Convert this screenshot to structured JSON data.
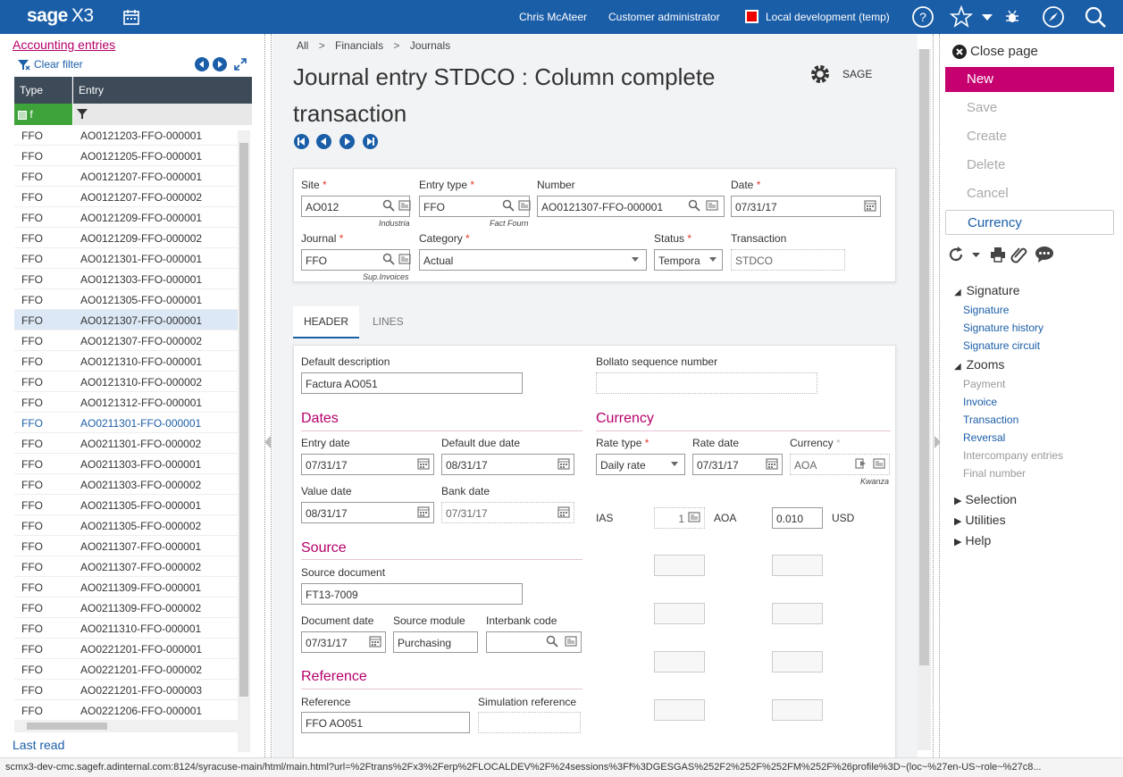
{
  "topbar": {
    "brand": "sage",
    "product": "X3",
    "user": "Chris McAteer",
    "role": "Customer administrator",
    "endpoint": "Local development (temp)",
    "color": "#1b5ea8"
  },
  "left": {
    "title": "Accounting entries",
    "clear_filter": "Clear filter",
    "col_type": "Type",
    "col_entry": "Entry",
    "filter_value": "f",
    "rows": [
      [
        "FFO",
        "AO0121203-FFO-000001"
      ],
      [
        "FFO",
        "AO0121205-FFO-000001"
      ],
      [
        "FFO",
        "AO0121207-FFO-000001"
      ],
      [
        "FFO",
        "AO0121207-FFO-000002"
      ],
      [
        "FFO",
        "AO0121209-FFO-000001"
      ],
      [
        "FFO",
        "AO0121209-FFO-000002"
      ],
      [
        "FFO",
        "AO0121301-FFO-000001"
      ],
      [
        "FFO",
        "AO0121303-FFO-000001"
      ],
      [
        "FFO",
        "AO0121305-FFO-000001"
      ],
      [
        "FFO",
        "AO0121307-FFO-000001"
      ],
      [
        "FFO",
        "AO0121307-FFO-000002"
      ],
      [
        "FFO",
        "AO0121310-FFO-000001"
      ],
      [
        "FFO",
        "AO0121310-FFO-000002"
      ],
      [
        "FFO",
        "AO0121312-FFO-000001"
      ],
      [
        "FFO",
        "AO0211301-FFO-000001"
      ],
      [
        "FFO",
        "AO0211301-FFO-000002"
      ],
      [
        "FFO",
        "AO0211303-FFO-000001"
      ],
      [
        "FFO",
        "AO0211303-FFO-000002"
      ],
      [
        "FFO",
        "AO0211305-FFO-000001"
      ],
      [
        "FFO",
        "AO0211305-FFO-000002"
      ],
      [
        "FFO",
        "AO0211307-FFO-000001"
      ],
      [
        "FFO",
        "AO0211307-FFO-000002"
      ],
      [
        "FFO",
        "AO0211309-FFO-000001"
      ],
      [
        "FFO",
        "AO0211309-FFO-000002"
      ],
      [
        "FFO",
        "AO0211310-FFO-000001"
      ],
      [
        "FFO",
        "AO0221201-FFO-000001"
      ],
      [
        "FFO",
        "AO0221201-FFO-000002"
      ],
      [
        "FFO",
        "AO0221201-FFO-000003"
      ],
      [
        "FFO",
        "AO0221206-FFO-000001"
      ]
    ],
    "selected_index": 9,
    "highlight_index": 14,
    "last_read": "Last read"
  },
  "main": {
    "breadcrumb": [
      "All",
      "Financials",
      "Journals"
    ],
    "title": "Journal entry STDCO : Column complete transaction",
    "sage_label": "SAGE",
    "form": {
      "site_label": "Site",
      "site_value": "AO012",
      "site_hint": "Industria",
      "entry_type_label": "Entry type",
      "entry_type_value": "FFO",
      "entry_type_hint": "Fact Fourn",
      "number_label": "Number",
      "number_value": "AO0121307-FFO-000001",
      "date_label": "Date",
      "date_value": "07/31/17",
      "journal_label": "Journal",
      "journal_value": "FFO",
      "journal_hint": "Sup.Invoices",
      "category_label": "Category",
      "category_value": "Actual",
      "status_label": "Status",
      "status_value": "Tempora",
      "transaction_label": "Transaction",
      "transaction_value": "STDCO"
    },
    "tabs": [
      "HEADER",
      "LINES"
    ],
    "header": {
      "default_desc_label": "Default description",
      "default_desc_value": "Factura AO051",
      "bollato_label": "Bollato sequence number",
      "bollato_value": "",
      "dates_title": "Dates",
      "entry_date_label": "Entry date",
      "entry_date_value": "07/31/17",
      "due_date_label": "Default due date",
      "due_date_value": "08/31/17",
      "value_date_label": "Value date",
      "value_date_value": "08/31/17",
      "bank_date_label": "Bank date",
      "bank_date_value": "07/31/17",
      "currency_title": "Currency",
      "rate_type_label": "Rate type",
      "rate_type_value": "Daily rate",
      "rate_date_label": "Rate date",
      "rate_date_value": "07/31/17",
      "currency_label": "Currency",
      "currency_value": "AOA",
      "currency_hint": "Kwanza",
      "ias_label": "IAS",
      "ias_qty": "1",
      "ias_cur1": "AOA",
      "ias_rate": "0.010",
      "ias_cur2": "USD",
      "source_title": "Source",
      "source_doc_label": "Source document",
      "source_doc_value": "FT13-7009",
      "doc_date_label": "Document date",
      "doc_date_value": "07/31/17",
      "source_module_label": "Source module",
      "source_module_value": "Purchasing",
      "interbank_label": "Interbank code",
      "interbank_value": "",
      "reference_title": "Reference",
      "reference_label": "Reference",
      "reference_value": "FFO AO051",
      "sim_ref_label": "Simulation reference",
      "sim_ref_value": ""
    }
  },
  "right": {
    "close_page": "Close page",
    "actions": [
      "New",
      "Save",
      "Create",
      "Delete",
      "Cancel",
      "Currency"
    ],
    "signature_title": "Signature",
    "signature_links": [
      "Signature",
      "Signature history",
      "Signature circuit"
    ],
    "zooms_title": "Zooms",
    "zooms_links": [
      {
        "label": "Payment",
        "enabled": false
      },
      {
        "label": "Invoice",
        "enabled": true
      },
      {
        "label": "Transaction",
        "enabled": true
      },
      {
        "label": "Reversal",
        "enabled": true
      },
      {
        "label": "Intercompany entries",
        "enabled": false
      },
      {
        "label": "Final number",
        "enabled": false
      }
    ],
    "selection": "Selection",
    "utilities": "Utilities",
    "help": "Help",
    "accent": "#c6006f"
  },
  "status_url": "scmx3-dev-cmc.sagefr.adinternal.com:8124/syracuse-main/html/main.html?url=%2Ftrans%2Fx3%2Ferp%2FLOCALDEV%2F%24sessions%3Ff%3DGESGAS%252F2%252F%252FM%252F%26profile%3D~(loc~%27en-US~role~%27c8..."
}
